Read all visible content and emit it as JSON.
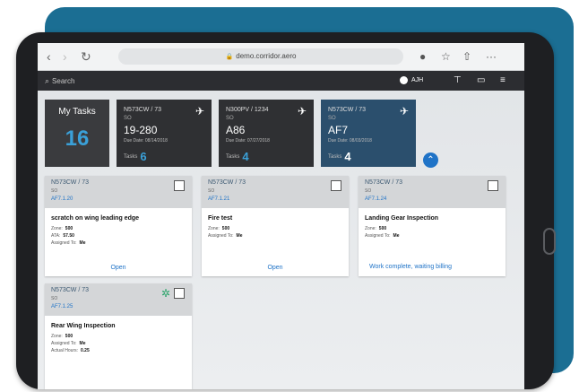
{
  "browser": {
    "url": "demo.corridor.aero",
    "lock_icon": "lock-icon"
  },
  "appbar": {
    "search_placeholder": "Search",
    "user_initials": "AJH"
  },
  "tiles": [
    {
      "title": "My Tasks",
      "count": "16"
    },
    {
      "flight": "N573CW / 73",
      "sub": "SO",
      "ident": "19-280",
      "small": "Due Date: 08/14/2018",
      "count_label": "Tasks",
      "count": "6"
    },
    {
      "flight": "N300PV / 1234",
      "sub": "SO",
      "ident": "A86",
      "small": "Due Date: 07/27/2018",
      "count_label": "Tasks",
      "count": "4"
    },
    {
      "flight": "N573CW / 73",
      "sub": "SO",
      "ident": "AF7",
      "small": "Due Date: 08/03/2018",
      "count_label": "Tasks",
      "count": "4"
    }
  ],
  "cards": [
    {
      "flight": "N573CW / 73",
      "sub": "SO",
      "wo": "AF7.1.20",
      "title": "scratch on wing leading edge",
      "rows": [
        [
          "Zone:",
          "500"
        ],
        [
          "ATA:",
          "57.50"
        ],
        [
          "Assigned To:",
          "Me"
        ]
      ],
      "status": "Open"
    },
    {
      "flight": "N573CW / 73",
      "sub": "SO",
      "wo": "AF7.1.21",
      "title": "Fire test",
      "rows": [
        [
          "Zone:",
          "500"
        ],
        [
          "Assigned To:",
          "Me"
        ]
      ],
      "status": "Open"
    },
    {
      "flight": "N573CW / 73",
      "sub": "SO",
      "wo": "AF7.1.24",
      "title": "Landing Gear Inspection",
      "rows": [
        [
          "Zone:",
          "500"
        ],
        [
          "Assigned To:",
          "Me"
        ]
      ],
      "status": "Work complete, waiting billing"
    },
    {
      "flight": "N573CW / 73",
      "sub": "SO",
      "wo": "AF7.1.25",
      "title": "Rear Wing Inspection",
      "rows": [
        [
          "Zone:",
          "500"
        ],
        [
          "Assigned To:",
          "Me"
        ],
        [
          "Actual Hours:",
          "0.25"
        ]
      ],
      "status": ""
    }
  ],
  "colors": {
    "accent": "#1f73c7",
    "background_panel": "#1b6e93",
    "active_tile": "#2b4f6d"
  }
}
